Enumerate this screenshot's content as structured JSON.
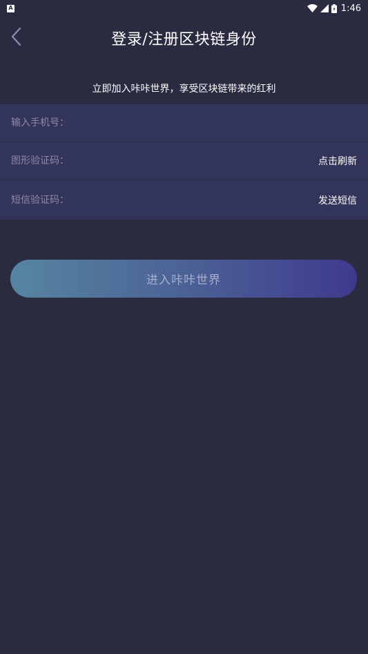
{
  "status_bar": {
    "time": "1:46",
    "notification_glyph": "A",
    "icons": [
      "wifi-icon",
      "signal-icon",
      "battery-icon"
    ]
  },
  "header": {
    "title": "登录/注册区块链身份",
    "back_icon": "chevron-left-icon"
  },
  "subtitle": "立即加入咔咔世界，享受区块链带来的红利",
  "form": {
    "phone": {
      "placeholder": "输入手机号："
    },
    "captcha": {
      "placeholder": "图形验证码：",
      "action": "点击刷新"
    },
    "sms": {
      "placeholder": "短信验证码：",
      "action": "发送短信"
    }
  },
  "enter_button": {
    "label": "进入咔咔世界"
  },
  "colors": {
    "background": "#2a2a41",
    "form_background": "#33345a",
    "button_gradient_start": "#5785a0",
    "button_gradient_end": "#3e3a8e",
    "placeholder": "#8a8aa6"
  }
}
